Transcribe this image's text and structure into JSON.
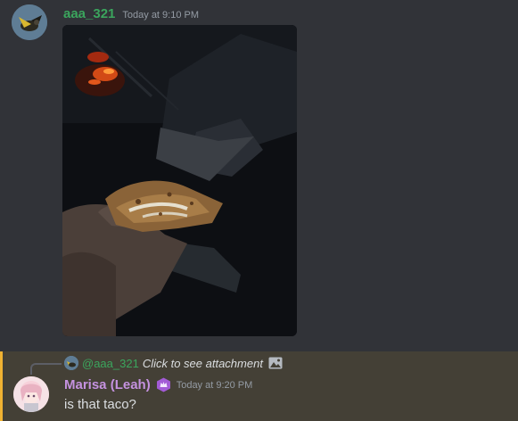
{
  "message1": {
    "username": "aaa_321",
    "timestamp": "Today at 9:10 PM",
    "avatar_icon": "bird-avatar",
    "attachment_icon": "photo-attachment"
  },
  "message2": {
    "reply": {
      "mention": "@aaa_321",
      "text": "Click to see attachment",
      "icon": "image-icon"
    },
    "username": "Marisa (Leah)",
    "role_icon": "purple-badge",
    "timestamp": "Today at 9:20 PM",
    "content": "is that taco?",
    "highlight_color": "#f0b232"
  },
  "colors": {
    "background": "#313338",
    "username_green": "#3ba55d",
    "username_purple": "#c592e0",
    "highlight_bg": "#444036"
  }
}
